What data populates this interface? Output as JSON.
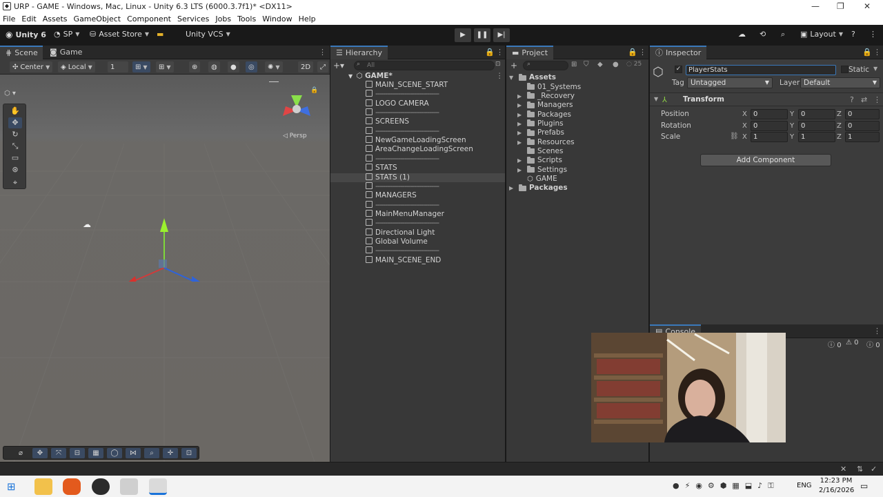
{
  "window": {
    "title": "URP - GAME - Windows, Mac, Linux - Unity 6.3 LTS (6000.3.7f1)* <DX11>",
    "controls": [
      "—",
      "❐",
      "✕"
    ]
  },
  "menu": [
    "File",
    "Edit",
    "Assets",
    "GameObject",
    "Component",
    "Services",
    "Jobs",
    "Tools",
    "Window",
    "Help"
  ],
  "toolbar": {
    "unity_label": "Unity 6",
    "account": "SP",
    "asset_store": "Asset Store",
    "vcs": "Unity VCS",
    "layout": "Layout"
  },
  "scene": {
    "tabs": [
      "Scene",
      "Game"
    ],
    "pivot": "Center",
    "space": "Local",
    "snap": "1",
    "gizmo_persp": "◁ Persp"
  },
  "hierarchy": {
    "tab": "Hierarchy",
    "search_placeholder": "All",
    "root": "GAME*",
    "items": [
      {
        "label": "MAIN_SCENE_START",
        "sep": false
      },
      {
        "label": "---------------------------------",
        "sep": true
      },
      {
        "label": "LOGO CAMERA",
        "sep": false
      },
      {
        "label": "---------------------------------",
        "sep": true
      },
      {
        "label": "SCREENS",
        "sep": false
      },
      {
        "label": "---------------------------------",
        "sep": true
      },
      {
        "label": "NewGameLoadingScreen",
        "sep": false
      },
      {
        "label": "AreaChangeLoadingScreen",
        "sep": false
      },
      {
        "label": "---------------------------------",
        "sep": true
      },
      {
        "label": "STATS",
        "sep": false
      },
      {
        "label": "STATS (1)",
        "sep": false
      },
      {
        "label": "---------------------------------",
        "sep": true
      },
      {
        "label": "MANAGERS",
        "sep": false
      },
      {
        "label": "---------------------------------",
        "sep": true
      },
      {
        "label": "MainMenuManager",
        "sep": false
      },
      {
        "label": "---------------------------------",
        "sep": true
      },
      {
        "label": "Directional Light",
        "sep": false
      },
      {
        "label": "Global Volume",
        "sep": false
      },
      {
        "label": "---------------------------------",
        "sep": true
      },
      {
        "label": "MAIN_SCENE_END",
        "sep": false
      }
    ],
    "selected_index": 10
  },
  "project": {
    "tab": "Project",
    "count": "25",
    "assets_label": "Assets",
    "folders": [
      "01_Systems",
      "_Recovery",
      "Managers",
      "Packages",
      "Plugins",
      "Prefabs",
      "Resources",
      "Scenes",
      "Scripts",
      "Settings",
      "GAME"
    ],
    "packages_label": "Packages"
  },
  "inspector": {
    "tab": "Inspector",
    "name_value": "PlayerStats",
    "static_label": "Static",
    "tag_label": "Tag",
    "tag_value": "Untagged",
    "layer_label": "Layer",
    "layer_value": "Default",
    "component": "Transform",
    "rows": [
      {
        "label": "Position",
        "x": "0",
        "y": "0",
        "z": "0"
      },
      {
        "label": "Rotation",
        "x": "0",
        "y": "0",
        "z": "0"
      },
      {
        "label": "Scale",
        "x": "1",
        "y": "1",
        "z": "1"
      }
    ],
    "axis": [
      "X",
      "Y",
      "Z"
    ],
    "add_component": "Add Component"
  },
  "console": {
    "tab": "Console",
    "counts": [
      "0",
      "0",
      "0"
    ]
  },
  "taskbar": {
    "lang": "ENG",
    "time": "12:23 PM",
    "date": "2/16/2026"
  },
  "colors": {
    "accent": "#3a79bb",
    "panel": "#383838",
    "selection": "#474747"
  }
}
